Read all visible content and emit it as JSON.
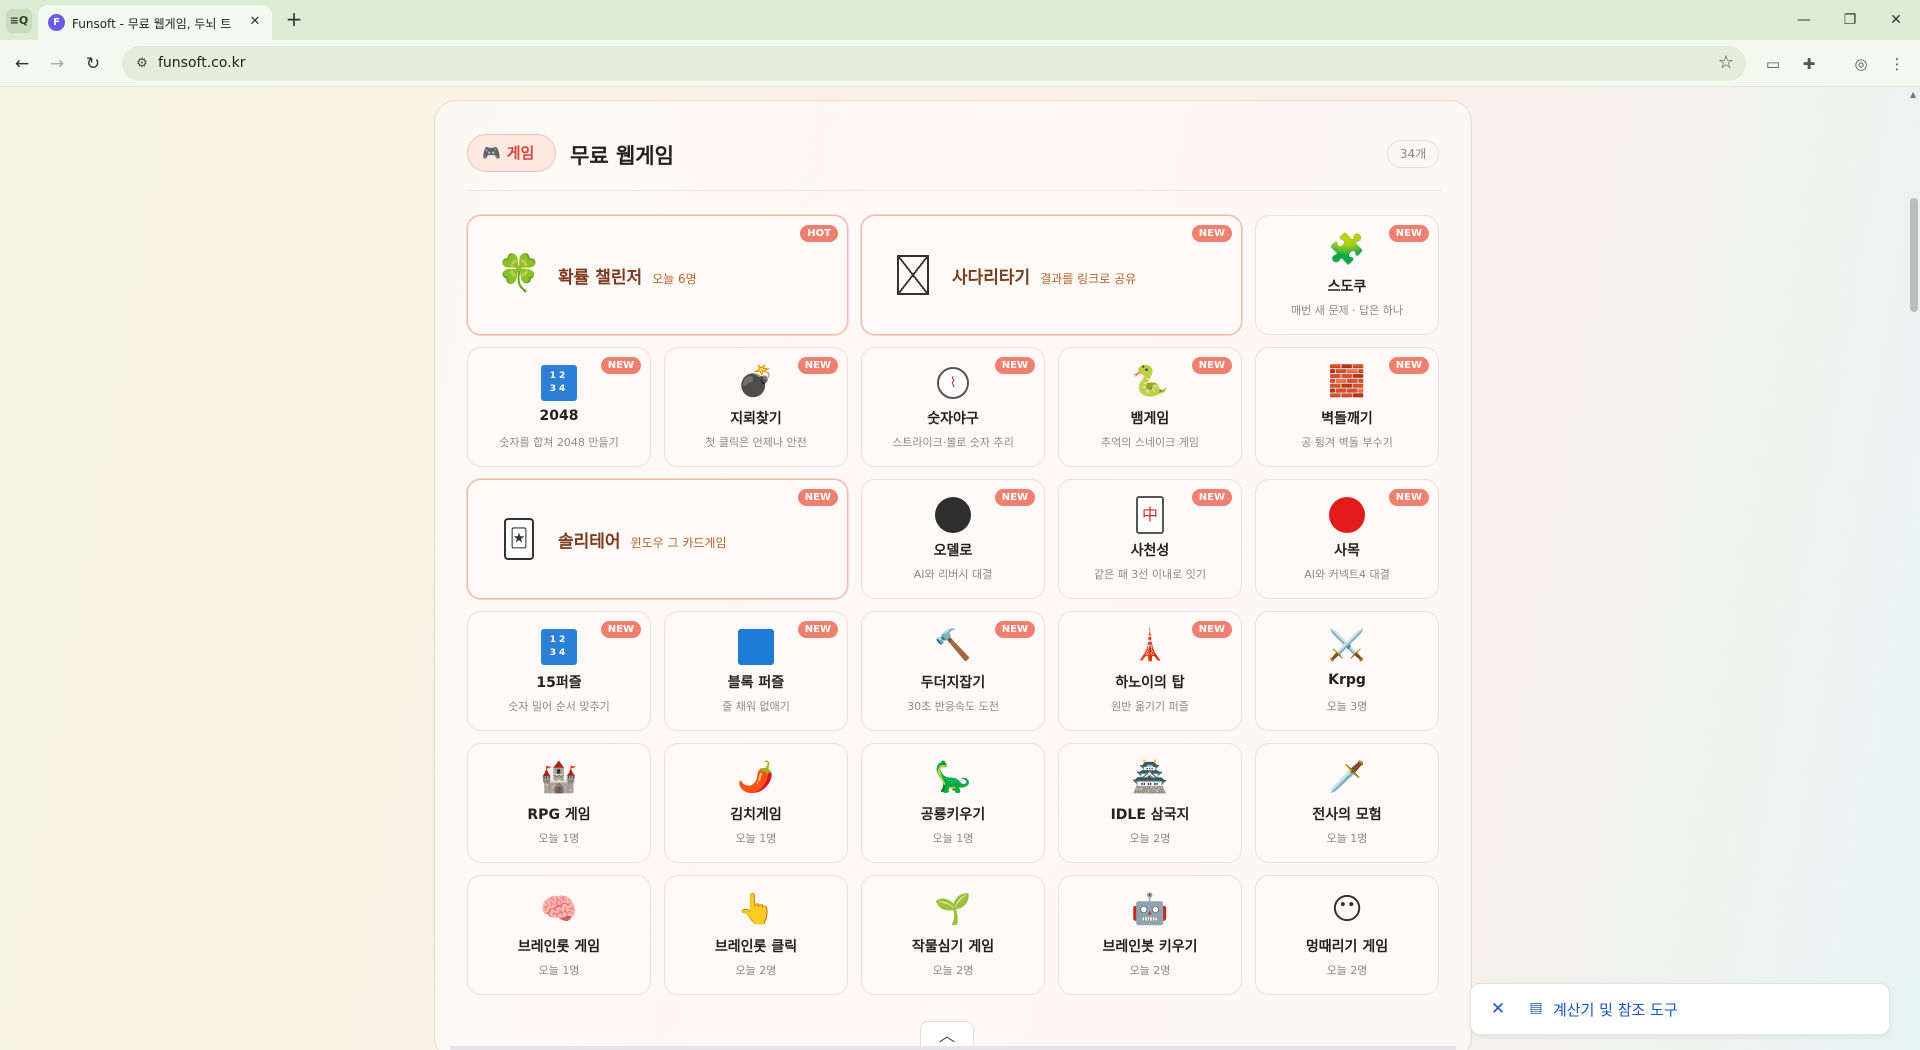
{
  "browser": {
    "tab_title": "Funsoft - 무료 웹게임, 두뇌 트",
    "tab_favicon": "F",
    "tab_search_icon": "tab-search-icon",
    "url": "funsoft.co.kr"
  },
  "section": {
    "pill_label": "게임",
    "pill_icon": "🎮",
    "title": "무료 웹게임",
    "count": "34개"
  },
  "games": [
    {
      "name": "확률 챌린저",
      "sub": "오늘 6명",
      "badge": "HOT",
      "icon": "🍀"
    },
    {
      "name": "사다리타기",
      "sub": "결과를 링크로 공유",
      "badge": "NEW",
      "icon": "box-x-icon"
    },
    {
      "name": "스도쿠",
      "sub": "매번 새 문제 · 답은 하나",
      "badge": "NEW",
      "icon": "🧩"
    },
    {
      "name": "2048",
      "sub": "숫자를 합쳐 2048 만들기",
      "badge": "NEW",
      "icon": "tile-1234-icon",
      "tile_text": "12 34"
    },
    {
      "name": "지뢰찾기",
      "sub": "첫 클릭은 언제나 안전",
      "badge": "NEW",
      "icon": "💣"
    },
    {
      "name": "숫자야구",
      "sub": "스트라이크·볼로 숫자 추리",
      "badge": "NEW",
      "icon": "baseball-icon"
    },
    {
      "name": "뱀게임",
      "sub": "추억의 스네이크 게임",
      "badge": "NEW",
      "icon": "🐍"
    },
    {
      "name": "벽돌깨기",
      "sub": "공 튕겨 벽돌 부수기",
      "badge": "NEW",
      "icon": "🧱"
    },
    {
      "name": "솔리테어",
      "sub": "윈도우 그 카드게임",
      "badge": "NEW",
      "icon": "joker-card-icon"
    },
    {
      "name": "오델로",
      "sub": "AI와 리버시 대결",
      "badge": "NEW",
      "icon": "black-disc-icon",
      "color": "#2f2f2f"
    },
    {
      "name": "사천성",
      "sub": "같은 패 3선 이내로 잇기",
      "badge": "NEW",
      "icon": "mahjong-tile-icon",
      "tile_text": "中"
    },
    {
      "name": "사목",
      "sub": "AI와 커넥트4 대결",
      "badge": "NEW",
      "icon": "red-disc-icon",
      "color": "#e31b1b"
    },
    {
      "name": "15퍼즐",
      "sub": "숫자 밀어 순서 맞추기",
      "badge": "NEW",
      "icon": "tile-1234-icon",
      "tile_text": "12 34"
    },
    {
      "name": "블록 퍼즐",
      "sub": "줄 채워 없애기",
      "badge": "NEW",
      "icon": "blue-square-icon"
    },
    {
      "name": "두더지잡기",
      "sub": "30초 반응속도 도전",
      "badge": "NEW",
      "icon": "🔨"
    },
    {
      "name": "하노이의 탑",
      "sub": "원반 옮기기 퍼즐",
      "badge": "NEW",
      "icon": "🗼"
    },
    {
      "name": "Krpg",
      "sub": "오늘 3명",
      "badge": "",
      "icon": "⚔️"
    },
    {
      "name": "RPG 게임",
      "sub": "오늘 1명",
      "badge": "",
      "icon": "🏰"
    },
    {
      "name": "김치게임",
      "sub": "오늘 1명",
      "badge": "",
      "icon": "🌶️"
    },
    {
      "name": "공룡키우기",
      "sub": "오늘 1명",
      "badge": "",
      "icon": "🦕"
    },
    {
      "name": "IDLE 삼국지",
      "sub": "오늘 2명",
      "badge": "",
      "icon": "🏯"
    },
    {
      "name": "전사의 모험",
      "sub": "오늘 1명",
      "badge": "",
      "icon": "🗡️"
    },
    {
      "name": "브레인롯 게임",
      "sub": "오늘 1명",
      "badge": "",
      "icon": "🧠"
    },
    {
      "name": "브레인롯 클릭",
      "sub": "오늘 2명",
      "badge": "",
      "icon": "👆"
    },
    {
      "name": "작물심기 게임",
      "sub": "오늘 2명",
      "badge": "",
      "icon": "🌱"
    },
    {
      "name": "브레인봇 키우기",
      "sub": "오늘 2명",
      "badge": "",
      "icon": "🤖"
    },
    {
      "name": "멍때리기 게임",
      "sub": "오늘 2명",
      "badge": "",
      "icon": "😶"
    }
  ],
  "side_panel": {
    "label": "계산기 및 참조 도구",
    "close_icon": "close-icon"
  },
  "colors": {
    "accent": "#d9443a",
    "badge": "#ef7f6e",
    "wide_title": "#7b3b1c",
    "link_blue": "#1a56c4"
  }
}
